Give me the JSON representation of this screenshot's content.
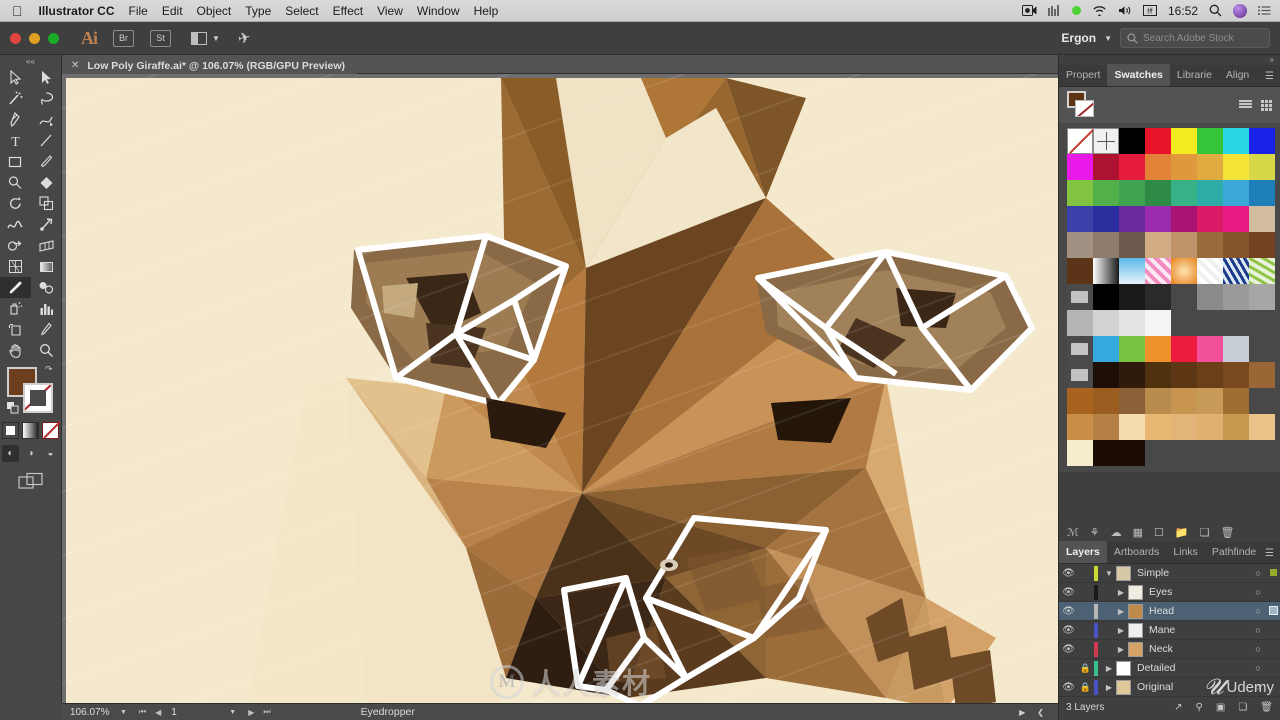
{
  "macbar": {
    "apple_icon": "apple-logo",
    "app_name": "Illustrator CC",
    "menus": [
      "File",
      "Edit",
      "Object",
      "Type",
      "Select",
      "Effect",
      "View",
      "Window",
      "Help"
    ],
    "status_icons": [
      "screen-record-icon",
      "equalizer-icon",
      "green-dot-icon",
      "wifi-icon",
      "volume-icon",
      "input-source-icon"
    ],
    "clock": "16:52",
    "search_icon": "spotlight-search-icon",
    "siri_icon": "siri-icon",
    "notification_icon": "notification-center-icon"
  },
  "appbar": {
    "logo": "Ai",
    "bridge_label": "Br",
    "stock_label": "St",
    "arrange_icon": "arrange-documents-icon",
    "plane_icon": "paper-plane-icon",
    "workspace": "Ergon",
    "workspace_caret": "chevron-down-icon",
    "search": {
      "icon": "search-icon",
      "placeholder": "Search Adobe Stock"
    }
  },
  "document": {
    "tab_title": "Low Poly Giraffe.ai* @ 106.07% (RGB/GPU Preview)",
    "close_icon": "close-icon"
  },
  "toolbar": {
    "collapse_icon": "collapse-panel-icon",
    "tools": [
      {
        "name": "selection-tool",
        "glyph": "▷"
      },
      {
        "name": "direct-selection-tool",
        "glyph": "▶"
      },
      {
        "name": "magic-wand-tool",
        "glyph": "✦"
      },
      {
        "name": "lasso-tool",
        "glyph": "◠"
      },
      {
        "name": "pen-tool",
        "glyph": "✒"
      },
      {
        "name": "curvature-tool",
        "glyph": "✎"
      },
      {
        "name": "type-tool",
        "glyph": "T"
      },
      {
        "name": "line-segment-tool",
        "glyph": "／"
      },
      {
        "name": "rectangle-tool",
        "glyph": "▢"
      },
      {
        "name": "paintbrush-tool",
        "glyph": "🖌"
      },
      {
        "name": "shaper-tool",
        "glyph": "◌"
      },
      {
        "name": "eraser-tool",
        "glyph": "◆"
      },
      {
        "name": "rotate-tool",
        "glyph": "↺"
      },
      {
        "name": "scale-tool",
        "glyph": "⛶"
      },
      {
        "name": "width-tool",
        "glyph": "∾"
      },
      {
        "name": "free-transform-tool",
        "glyph": "✚"
      },
      {
        "name": "shape-builder-tool",
        "glyph": "◔"
      },
      {
        "name": "perspective-grid-tool",
        "glyph": "◩"
      },
      {
        "name": "mesh-tool",
        "glyph": "▩"
      },
      {
        "name": "gradient-tool",
        "glyph": "▭"
      },
      {
        "name": "eyedropper-tool",
        "glyph": "✐",
        "selected": true
      },
      {
        "name": "blend-tool",
        "glyph": "❂"
      },
      {
        "name": "symbol-sprayer-tool",
        "glyph": "⁂"
      },
      {
        "name": "column-graph-tool",
        "glyph": "▥"
      },
      {
        "name": "artboard-tool",
        "glyph": "⊐"
      },
      {
        "name": "slice-tool",
        "glyph": "✂"
      },
      {
        "name": "hand-tool",
        "glyph": "✋"
      },
      {
        "name": "zoom-tool",
        "glyph": "🔍"
      }
    ],
    "fill_color": "#6b3f1d",
    "stroke_color": "#ffffff",
    "swap_icon": "swap-fill-stroke-icon",
    "default_icon": "default-fill-stroke-icon",
    "color_modes": [
      "color-mode-button",
      "gradient-mode-button",
      "none-mode-button"
    ],
    "draw_modes": [
      "draw-normal-button",
      "draw-behind-button",
      "draw-inside-button"
    ],
    "screen_mode_icon": "change-screen-mode-icon"
  },
  "panels": {
    "top_tabs": [
      {
        "label": "Propert",
        "name": "tab-properties",
        "active": false
      },
      {
        "label": "Swatches",
        "name": "tab-swatches",
        "active": true
      },
      {
        "label": "Librarie",
        "name": "tab-libraries",
        "active": false
      },
      {
        "label": "Align",
        "name": "tab-align",
        "active": false
      }
    ],
    "menu_icon": "panel-menu-icon",
    "swatches": {
      "fill_color": "#5d3314",
      "stroke_color": "none",
      "view_list_icon": "list-view-icon",
      "view_grid_icon": "grid-view-icon",
      "rows": [
        [
          "none",
          "registration",
          "#000000",
          "#e8142a",
          "#f4ec1f",
          "#35c43a",
          "#2ad8e5",
          "#1b22e8"
        ],
        [
          "#e818e8",
          "#ad1230",
          "#e71c3c",
          "#e3833a",
          "#e0983c",
          "#e0ab40",
          "#f2e335",
          "#d6d84a"
        ],
        [
          "#82c341",
          "#52b04b",
          "#3fa352",
          "#2e8b45",
          "#37b186",
          "#2eaca8",
          "#3aa8d8",
          "#1e7fb8"
        ],
        [
          "#3a41a8",
          "#2a2fa0",
          "#6a2b9e",
          "#9b2ab0",
          "#a91474",
          "#d91a66",
          "#e81a84",
          "#d1bca2"
        ],
        [
          "#a29183",
          "#8f7b6b",
          "#6d5a4c",
          "#d0ab83",
          "#bf9468",
          "#9a6c3c",
          "#85552c",
          "#744220"
        ],
        [
          "#5c3418",
          "gradient-white-black",
          "gradient-blue",
          "pattern-pink-dots",
          "gradient-orange-radial",
          "pattern-circle-dots",
          "pattern-blue-floral",
          "pattern-green-leaf"
        ],
        [
          "folder",
          "#000000",
          "#1b1b1b",
          "#2a2a2a",
          "",
          "#8a8a8a",
          "#9a9a9a",
          "#a6a6a6"
        ],
        [
          "#b5b5b5",
          "#d2d2d2",
          "#e4e4e4",
          "#f4f4f4",
          "",
          "",
          "",
          ""
        ],
        [
          "folder",
          "#35a8e0",
          "#79c342",
          "#f0922b",
          "#ed1c3e",
          "#f2509a",
          "#c6cfd6",
          ""
        ],
        [
          "folder",
          "#1d0f06",
          "#2f1a0c",
          "#50300f",
          "#5d3714",
          "#6b4018",
          "#7a4a1e",
          "#9a6636"
        ],
        [
          "#a8641e",
          "#9b5c20",
          "#8a6136",
          "#b98c4e",
          "#c79550",
          "#c79a58",
          "#9e6e33",
          ""
        ],
        [
          "#c98f46",
          "#b58045",
          "#f2dcb0",
          "#e8b872",
          "#e2b477",
          "#e2b06e",
          "#c89750",
          "#eac389"
        ],
        [
          "#f6ecce",
          "#1b0c06",
          "#1b0c06",
          "",
          "",
          "",
          "",
          ""
        ]
      ]
    },
    "path_icons": [
      "symbols-icon",
      "brushes-icon",
      "libraries-cloud-icon",
      "image-trace-icon",
      "document-icon",
      "folder-icon",
      "new-layer-icon",
      "delete-icon"
    ],
    "layers_tabs": [
      {
        "label": "Layers",
        "name": "tab-layers",
        "active": true
      },
      {
        "label": "Artboards",
        "name": "tab-artboards",
        "active": false
      },
      {
        "label": "Links",
        "name": "tab-links",
        "active": false
      },
      {
        "label": "Pathfinde",
        "name": "tab-pathfinder",
        "active": false
      }
    ],
    "layers": [
      {
        "name": "Simple",
        "visible": true,
        "locked": false,
        "color": "#c8d636",
        "indent": 0,
        "expanded": true,
        "selected": false,
        "target": false,
        "sel_dot": "#9aab2b",
        "thumb": "#d8c9a6"
      },
      {
        "name": "Eyes",
        "visible": true,
        "locked": false,
        "color": "#1a1a1a",
        "indent": 1,
        "expanded": false,
        "selected": false,
        "target": false,
        "sel_dot": "",
        "thumb": "#f0ece2"
      },
      {
        "name": "Head",
        "visible": true,
        "locked": false,
        "color": "#b8b8b8",
        "indent": 1,
        "expanded": false,
        "selected": true,
        "target": true,
        "sel_dot": "#5a7a93",
        "thumb": "#c08a4a"
      },
      {
        "name": "Mane",
        "visible": true,
        "locked": false,
        "color": "#4a52c8",
        "indent": 1,
        "expanded": false,
        "selected": false,
        "target": false,
        "sel_dot": "",
        "thumb": "#efefef"
      },
      {
        "name": "Neck",
        "visible": true,
        "locked": false,
        "color": "#d03850",
        "indent": 1,
        "expanded": false,
        "selected": false,
        "target": false,
        "sel_dot": "",
        "thumb": "#d3a264"
      },
      {
        "name": "Detailed",
        "visible": false,
        "locked": true,
        "color": "#3ac08a",
        "indent": 0,
        "expanded": false,
        "selected": false,
        "target": false,
        "sel_dot": "",
        "thumb": "#ffffff"
      },
      {
        "name": "Original",
        "visible": true,
        "locked": true,
        "color": "#4a52c8",
        "indent": 0,
        "expanded": false,
        "selected": false,
        "target": false,
        "sel_dot": "",
        "thumb": "#e0c89a"
      }
    ],
    "layers_count": "3 Layers",
    "layers_footer_icons": [
      "locate-object-icon",
      "make-clipping-mask-icon",
      "create-new-sublayer-icon",
      "create-new-layer-icon",
      "delete-selection-icon"
    ]
  },
  "statusbar": {
    "zoom": "106.07%",
    "zoom_caret": "chevron-down-icon",
    "first_page_icon": "first-page-icon",
    "prev_page_icon": "previous-page-icon",
    "page": "1",
    "page_caret": "chevron-down-icon",
    "next_page_icon": "next-page-icon",
    "last_page_icon": "last-page-icon",
    "current_tool": "Eyedropper",
    "play_icon": "play-icon",
    "back_icon": "back-icon"
  },
  "artwork": {
    "title": "Low Poly Giraffe",
    "background": "#f5e9cd",
    "watermark_text": "人人素材",
    "watermark_logo": "renren-logo-icon",
    "udemy_watermark": "Udemy",
    "udemy_mark": "𝓤"
  }
}
